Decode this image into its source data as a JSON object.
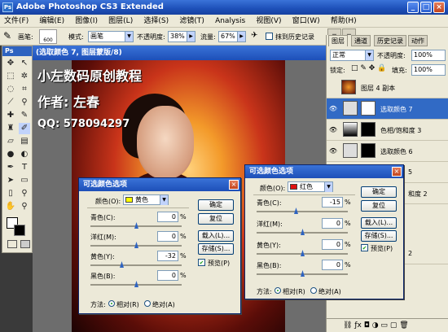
{
  "app": {
    "title": "Adobe Photoshop CS3 Extended",
    "icon": "Ps",
    "minimize": "_",
    "maximize": "□",
    "close": "×"
  },
  "menu": [
    "文件(F)",
    "编辑(E)",
    "图像(I)",
    "图层(L)",
    "选择(S)",
    "滤镜(T)",
    "Analysis",
    "视图(V)",
    "窗口(W)",
    "帮助(H)"
  ],
  "options": {
    "brush_label": "画笔:",
    "brush_size": "600",
    "mode_label": "模式:",
    "mode_value": "画笔",
    "opacity_label": "不透明度:",
    "opacity_value": "38%",
    "flow_label": "流量:",
    "flow_value": "67%",
    "history_label": "抹到历史记录"
  },
  "toolbox": {
    "header": "Ps"
  },
  "document": {
    "title": "(选取颜色 7, 图层蒙版/8)",
    "overlay_line1": "小左数码原创教程",
    "overlay_line2": "作者: 左春",
    "overlay_line3": "QQ: 578094297"
  },
  "layers_panel": {
    "tabs": [
      "图层",
      "通道",
      "历史记录",
      "动作"
    ],
    "blend_mode": "正常",
    "opacity_label": "不透明度:",
    "opacity_value": "100%",
    "lock_label": "锁定:",
    "fill_label": "填充:",
    "fill_value": "100%",
    "layers": [
      {
        "name": "图层 4 副本",
        "selected": false
      },
      {
        "name": "选取颜色 7",
        "selected": true
      },
      {
        "name": "色相/饱和度 3",
        "selected": false
      },
      {
        "name": "选取颜色 6",
        "selected": false
      },
      {
        "name": "5",
        "selected": false
      },
      {
        "name": "和度 2",
        "selected": false
      },
      {
        "name": "2",
        "selected": false
      }
    ]
  },
  "dialog_yellow": {
    "title": "可选颜色选项",
    "color_label": "颜色(O):",
    "color_value": "黄色",
    "color_swatch": "#ffff00",
    "cyan_label": "青色(C):",
    "cyan_value": "0",
    "magenta_label": "洋红(M):",
    "magenta_value": "0",
    "yellow_label": "黄色(Y):",
    "yellow_value": "-32",
    "black_label": "黑色(B):",
    "black_value": "0",
    "pct": "%",
    "ok": "确定",
    "reset": "复位",
    "load": "载入(L)...",
    "save": "存储(S)...",
    "preview": "预览(P)",
    "method_label": "方法:",
    "relative": "相对(R)",
    "absolute": "绝对(A)"
  },
  "dialog_red": {
    "title": "可选颜色选项",
    "color_label": "颜色(O):",
    "color_value": "红色",
    "color_swatch": "#e01010",
    "cyan_label": "青色(C):",
    "cyan_value": "-15",
    "magenta_label": "洋红(M):",
    "magenta_value": "0",
    "yellow_label": "黄色(Y):",
    "yellow_value": "0",
    "black_label": "黑色(B):",
    "black_value": "0",
    "pct": "%",
    "ok": "确定",
    "reset": "复位",
    "load": "载入(L)...",
    "save": "存储(S)...",
    "preview": "预览(P)",
    "method_label": "方法:",
    "relative": "相对(R)",
    "absolute": "绝对(A)"
  }
}
